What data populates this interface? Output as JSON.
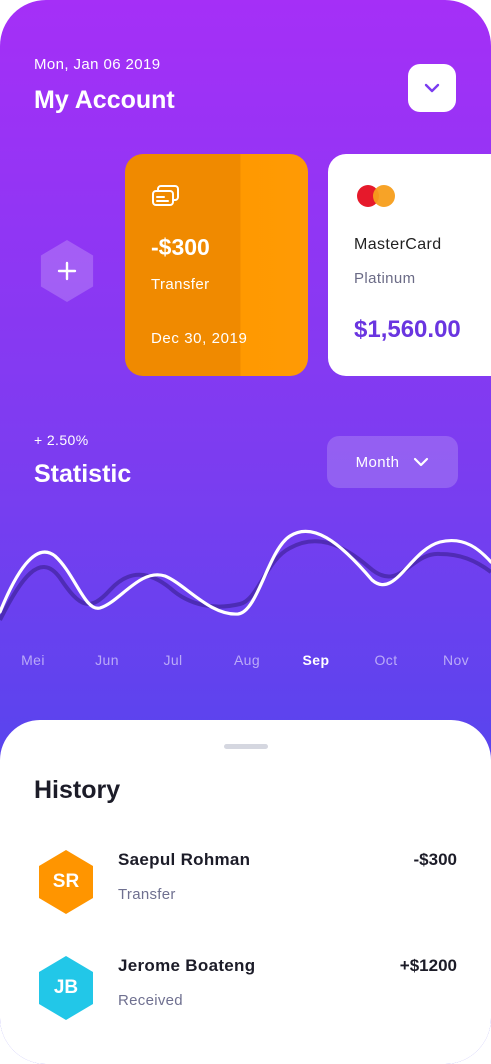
{
  "header": {
    "date": "Mon, Jan 06 2019",
    "title": "My Account",
    "dropdown_icon": "chevron-down-icon"
  },
  "cards": [
    {
      "icon": "card-icon",
      "amount": "-$300",
      "label": "Transfer",
      "date": "Dec 30, 2019",
      "color": "#ff9900"
    },
    {
      "icon": "mastercard-logo",
      "name": "MasterCard",
      "tier": "Platinum",
      "balance": "$1,560.00",
      "balance_color": "#6a35e0"
    }
  ],
  "add_card_icon": "plus-icon",
  "statistic": {
    "change": "+ 2.50%",
    "title": "Statistic",
    "period": "Month",
    "period_icon": "chevron-down-icon",
    "months": [
      "Mei",
      "Jun",
      "Jul",
      "Aug",
      "Sep",
      "Oct",
      "Nov"
    ],
    "active_month": "Sep"
  },
  "history": {
    "title": "History",
    "items": [
      {
        "initials": "SR",
        "name": "Saepul Rohman",
        "type": "Transfer",
        "amount": "-$300",
        "color": "#ff9500"
      },
      {
        "initials": "JB",
        "name": "Jerome Boateng",
        "type": "Received",
        "amount": "+$1200",
        "color": "#22c7e8"
      }
    ]
  },
  "colors": {
    "gradient_top": "#a52ff7",
    "gradient_bottom": "#4f46e8",
    "accent": "#6a35e0"
  }
}
